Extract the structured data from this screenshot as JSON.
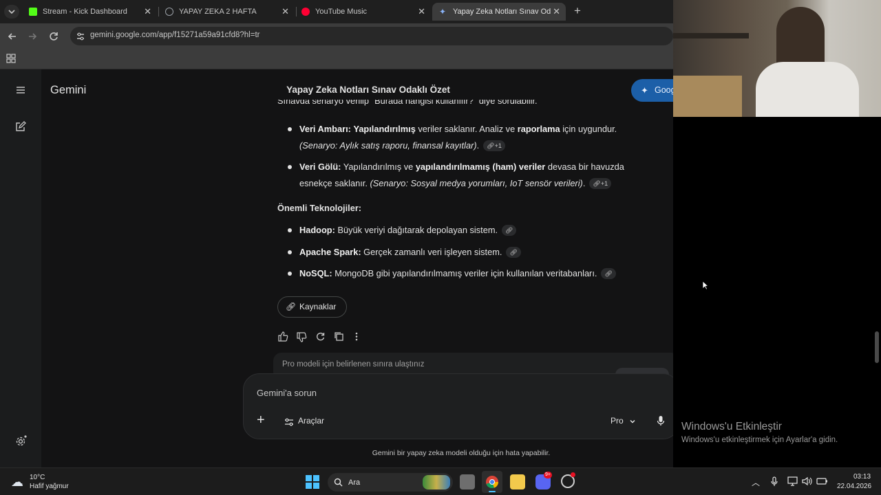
{
  "browser": {
    "tabs": [
      {
        "title": "Stream - Kick Dashboard",
        "favicon_color": "#53fc18",
        "active": false
      },
      {
        "title": "YAPAY ZEKA 2 HAFTA",
        "favicon_color": "#9aa0a6",
        "active": false
      },
      {
        "title": "YouTube Music",
        "favicon_color": "#ff0033",
        "active": false
      },
      {
        "title": "Yapay Zeka Notları Sınav Odaklı",
        "favicon_color": "#8ab4f8",
        "active": true
      }
    ],
    "url": "gemini.google.com/app/f15271a59a91cfd8?hl=tr"
  },
  "gemini": {
    "brand": "Gemini",
    "conversation_title": "Yapay Zeka Notları Sınav Odaklı Özet",
    "top_button_label": "Goog",
    "response": {
      "cut_line": "Sınavda senaryo verilip \"Burada hangisi kullanılır?\" diye sorulabilir.",
      "storage_items": [
        {
          "term": "Veri Ambarı:",
          "parts": [
            {
              "t": " ",
              "s": "n"
            },
            {
              "t": "Yapılandırılmış",
              "s": "b"
            },
            {
              "t": " veriler saklanır. Analiz ve ",
              "s": "n"
            },
            {
              "t": "raporlama",
              "s": "b"
            },
            {
              "t": " için uygundur. ",
              "s": "n"
            },
            {
              "t": "(Senaryo: Aylık satış raporu, finansal kayıtlar)",
              "s": "i"
            },
            {
              "t": ".",
              "s": "n"
            }
          ],
          "chip": "+1"
        },
        {
          "term": "Veri Gölü:",
          "parts": [
            {
              "t": " Yapılandırılmış ve ",
              "s": "n"
            },
            {
              "t": "yapılandırılmamış (ham) veriler",
              "s": "b"
            },
            {
              "t": " devasa bir havuzda esnekçe saklanır. ",
              "s": "n"
            },
            {
              "t": "(Senaryo: Sosyal medya yorumları, IoT sensör verileri)",
              "s": "i"
            },
            {
              "t": ".",
              "s": "n"
            }
          ],
          "chip": "+1"
        }
      ],
      "tech_heading": "Önemli Teknolojiler:",
      "tech_items": [
        {
          "term": "Hadoop:",
          "text": " Büyük veriyi dağıtarak depolayan sistem."
        },
        {
          "term": "Apache Spark:",
          "text": " Gerçek zamanlı veri işleyen sistem."
        },
        {
          "term": "NoSQL:",
          "text": " MongoDB gibi yapılandırılmamış veriler için kullanılan veritabanları."
        }
      ]
    },
    "sources_button": "Kaynaklar",
    "limit_notice": "Pro modeli için belirlenen sınıra ulaştınız",
    "composer": {
      "placeholder": "Gemini'a sorun",
      "tools_label": "Araçlar",
      "model_label": "Pro"
    },
    "disclaimer": "Gemini bir yapay zeka modeli olduğu için hata yapabilir."
  },
  "windows": {
    "activation_title": "Windows'u Etkinleştir",
    "activation_sub": "Windows'u etkinleştirmek için Ayarlar'a gidin.",
    "weather_temp": "10°C",
    "weather_desc": "Hafif yağmur",
    "search_label": "Ara",
    "time": "03:13",
    "date": "22.04.2026",
    "discord_badge": "9+"
  }
}
